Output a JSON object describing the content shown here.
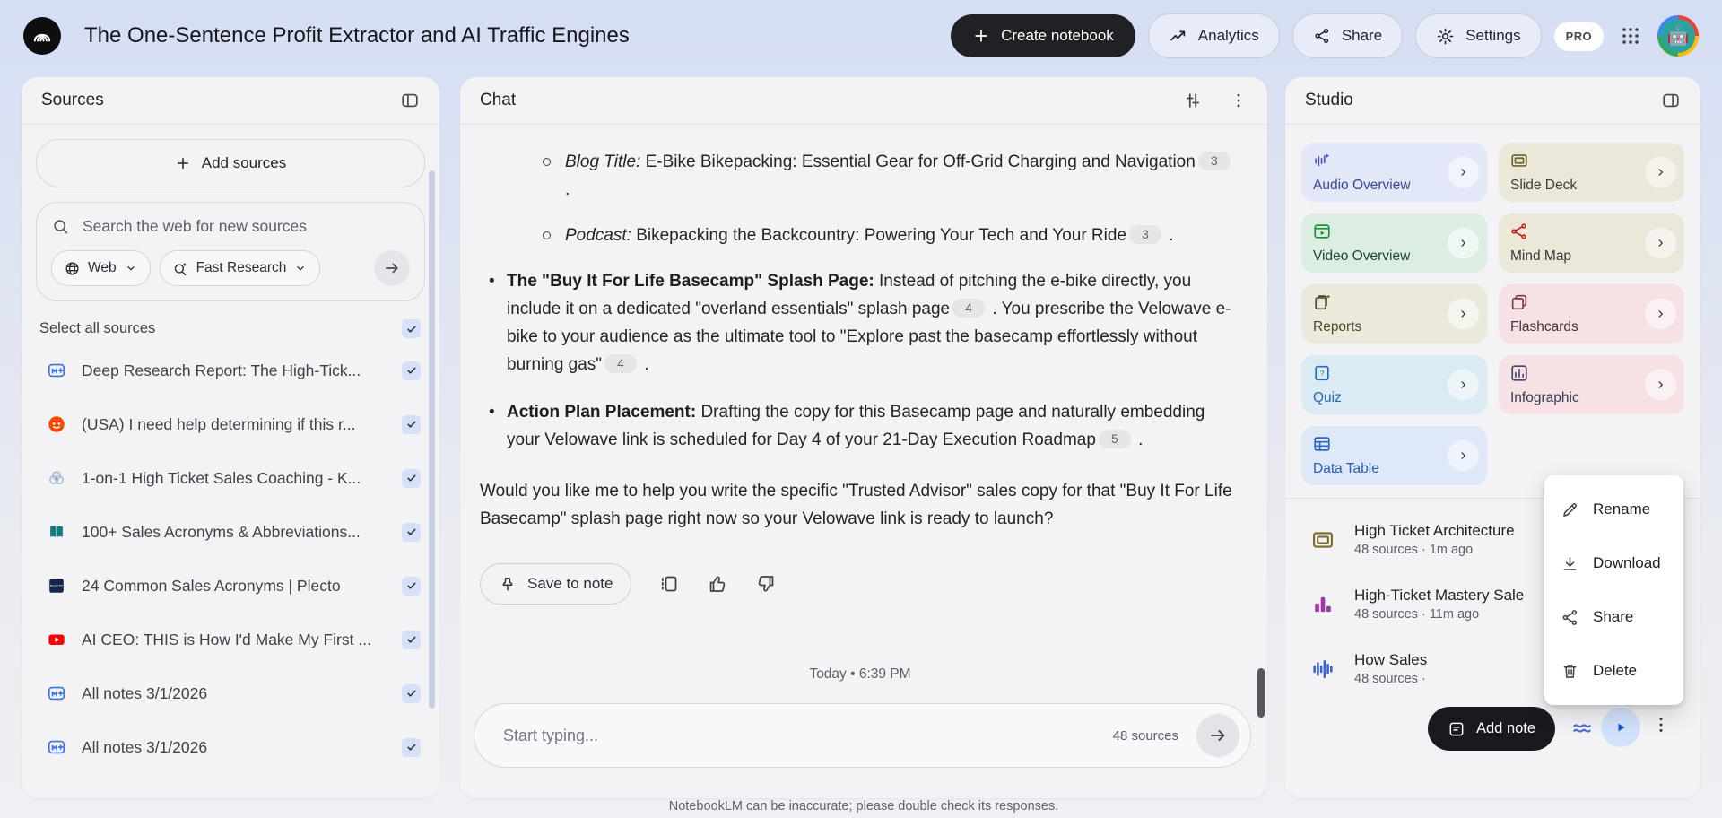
{
  "header": {
    "title": "The One-Sentence Profit Extractor and AI Traffic Engines",
    "create_notebook": "Create notebook",
    "analytics": "Analytics",
    "share": "Share",
    "settings": "Settings",
    "pro": "PRO"
  },
  "colors": {
    "accent_blue": "#0b57d0",
    "create_button_bg": "#202124",
    "add_note_bg": "#191a20",
    "play_circle_bg": "#d2e2fc",
    "checkbox_bg": "#d6e0f8"
  },
  "sources": {
    "title": "Sources",
    "add_button": "Add sources",
    "search_placeholder": "Search the web for new sources",
    "web_chip": "Web",
    "fast_research_chip": "Fast Research",
    "select_all": "Select all sources",
    "items": [
      {
        "icon": "notes",
        "title": "Deep Research Report: The High-Tick...",
        "checked": true
      },
      {
        "icon": "reddit",
        "title": "(USA) I need help determining if this r...",
        "checked": true
      },
      {
        "icon": "venn",
        "title": "1-on-1 High Ticket Sales Coaching - K...",
        "checked": true
      },
      {
        "icon": "book",
        "title": "100+ Sales Acronyms & Abbreviations...",
        "checked": true
      },
      {
        "icon": "plecto",
        "title": "24 Common Sales Acronyms | Plecto",
        "checked": true
      },
      {
        "icon": "youtube",
        "title": "AI CEO: THIS is How I'd Make My First ...",
        "checked": true
      },
      {
        "icon": "notes",
        "title": "All notes 3/1/2026",
        "checked": true
      },
      {
        "icon": "notes",
        "title": "All notes 3/1/2026",
        "checked": true
      }
    ]
  },
  "chat": {
    "title": "Chat",
    "paragraphs": [
      {
        "type": "sub",
        "segments": [
          {
            "t": "Blog Title:",
            "s": "i"
          },
          {
            "t": " E-Bike Bikepacking: Essential Gear for Off-Grid Charging and Navigation"
          },
          {
            "chip": "3"
          },
          {
            "t": " ."
          }
        ]
      },
      {
        "type": "sub",
        "segments": [
          {
            "t": "Podcast:",
            "s": "i"
          },
          {
            "t": " Bikepacking the Backcountry: Powering Your Tech and Your Ride"
          },
          {
            "chip": "3"
          },
          {
            "t": " ."
          }
        ]
      },
      {
        "type": "bullet",
        "segments": [
          {
            "t": "The \"Buy It For Life Basecamp\" Splash Page:",
            "s": "b"
          },
          {
            "t": " Instead of pitching the e-bike directly, you include it on a dedicated \"overland essentials\" splash page"
          },
          {
            "chip": "4"
          },
          {
            "t": " . You prescribe the Velowave e-bike to your audience as the ultimate tool to \"Explore past the basecamp effortlessly without burning gas\""
          },
          {
            "chip": "4"
          },
          {
            "t": " ."
          }
        ]
      },
      {
        "type": "bullet",
        "segments": [
          {
            "t": "Action Plan Placement:",
            "s": "b"
          },
          {
            "t": " Drafting the copy for this Basecamp page and naturally embedding your Velowave link is scheduled for Day 4 of your 21-Day Execution Roadmap"
          },
          {
            "chip": "5"
          },
          {
            "t": " ."
          }
        ]
      },
      {
        "type": "plain",
        "segments": [
          {
            "t": "Would you like me to help you write the specific \"Trusted Advisor\" sales copy for that \"Buy It For Life Basecamp\" splash page right now so your Velowave link is ready to launch?"
          }
        ]
      }
    ],
    "save_to_note": "Save to note",
    "timestamp": "Today • 6:39 PM",
    "input_placeholder": "Start typing...",
    "source_count": "48 sources",
    "disclaimer": "NotebookLM can be inaccurate; please double check its responses."
  },
  "studio": {
    "title": "Studio",
    "cards": [
      {
        "id": "audio",
        "label": "Audio Overview",
        "icon": "audio",
        "bg": "#e3e8f8",
        "fg": "#3a4896",
        "ic": "#4353c5"
      },
      {
        "id": "slides",
        "label": "Slide Deck",
        "icon": "frame",
        "bg": "#ebe7d9",
        "fg": "#3f3e30",
        "ic": "#6b6428"
      },
      {
        "id": "video",
        "label": "Video Overview",
        "icon": "video",
        "bg": "#dceee2",
        "fg": "#1d4c33",
        "ic": "#1e8e3e"
      },
      {
        "id": "mindmap",
        "label": "Mind Map",
        "icon": "mindmap",
        "bg": "#ebe7d9",
        "fg": "#37383c",
        "ic": "#c5221f"
      },
      {
        "id": "reports",
        "label": "Reports",
        "icon": "reports",
        "bg": "#ebe9dc",
        "fg": "#4a462a",
        "ic": "#4a4a28"
      },
      {
        "id": "flashcards",
        "label": "Flashcards",
        "icon": "cards",
        "bg": "#f6e2e5",
        "fg": "#43333b",
        "ic": "#7d3a45"
      },
      {
        "id": "quiz",
        "label": "Quiz",
        "icon": "quiz",
        "bg": "#daebf3",
        "fg": "#2a63b8",
        "ic": "#1f6cc5"
      },
      {
        "id": "infographic",
        "label": "Infographic",
        "icon": "infbars",
        "bg": "#f6e2e5",
        "fg": "#3a3a52",
        "ic": "#45466e"
      },
      {
        "id": "table",
        "label": "Data Table",
        "icon": "tablegrid",
        "bg": "#dfe8f8",
        "fg": "#2b5cb4",
        "ic": "#2666cf"
      }
    ],
    "artifacts": [
      {
        "icon": "frameolive",
        "ic": "#7a6a1f",
        "title": "High Ticket Architecture",
        "meta": "48 sources · 1m ago"
      },
      {
        "icon": "chartbars",
        "ic": "#a136a8",
        "title": "High-Ticket Mastery Sale",
        "meta": "48 sources · 11m ago"
      },
      {
        "icon": "wavebars",
        "ic": "#3b63d1",
        "title": "How Sales",
        "meta": "48 sources ·"
      }
    ],
    "add_note": "Add note"
  },
  "context_menu": {
    "items": [
      {
        "icon": "pencil",
        "label": "Rename"
      },
      {
        "icon": "download",
        "label": "Download"
      },
      {
        "icon": "sharenodes",
        "label": "Share"
      },
      {
        "icon": "trash",
        "label": "Delete"
      }
    ]
  }
}
